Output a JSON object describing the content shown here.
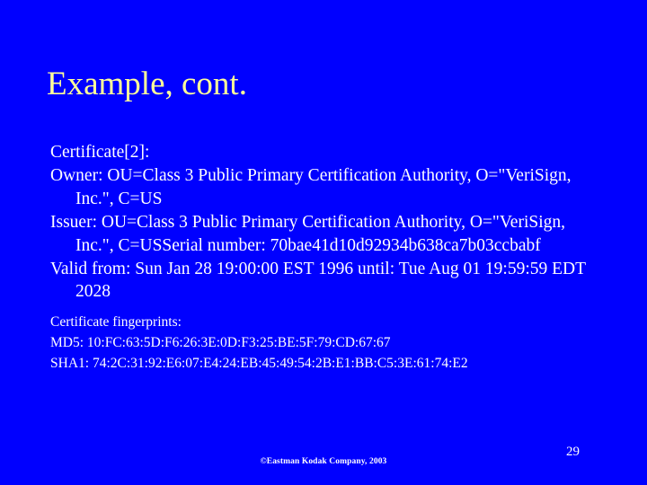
{
  "slide": {
    "title": "Example, cont.",
    "background_color": "#0000FF",
    "title_color": "#FFFF99",
    "body_color": "#FFFFFF",
    "page_number": "29",
    "footer": "©Eastman Kodak Company, 2003"
  },
  "body": {
    "paragraphs": [
      "Certificate[2]:",
      "Owner: OU=Class 3 Public Primary Certification Authority, O=\"VeriSign, Inc.\", C=US",
      "Issuer: OU=Class 3 Public Primary Certification Authority, O=\"VeriSign, Inc.\", C=USSerial number: 70bae41d10d92934b638ca7b03ccbabf",
      "Valid from: Sun Jan 28 19:00:00 EST 1996 until: Tue Aug 01 19:59:59 EDT 2028"
    ]
  },
  "fingerprints": {
    "heading": "Certificate fingerprints:",
    "md5": "MD5:  10:FC:63:5D:F6:26:3E:0D:F3:25:BE:5F:79:CD:67:67",
    "sha1": "SHA1: 74:2C:31:92:E6:07:E4:24:EB:45:49:54:2B:E1:BB:C5:3E:61:74:E2"
  }
}
